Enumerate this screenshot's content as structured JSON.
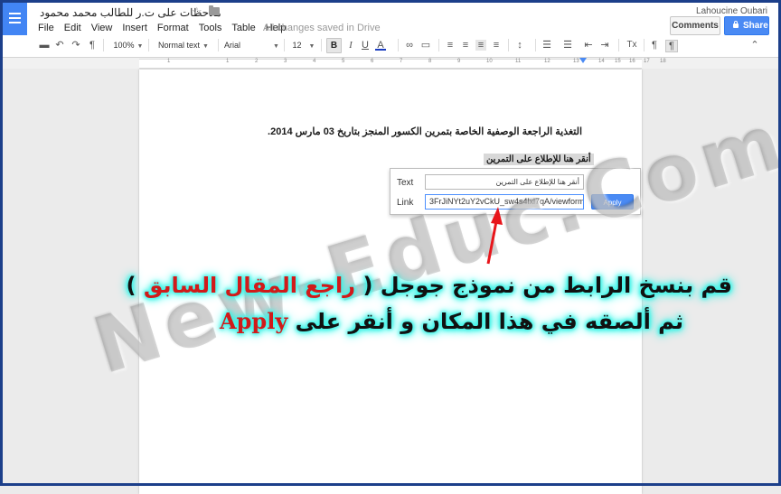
{
  "header": {
    "title": "ملاحظات على ت.ر للطالب محمد محمود",
    "save_status": "All changes saved in Drive",
    "user_name": "Lahoucine Oubari",
    "comments_label": "Comments",
    "share_label": "Share"
  },
  "menu": [
    "File",
    "Edit",
    "View",
    "Insert",
    "Format",
    "Tools",
    "Table",
    "Help"
  ],
  "toolbar": {
    "zoom": "100%",
    "style": "Normal text",
    "font": "Arial",
    "size": "12",
    "bold": "B",
    "italic": "I",
    "underline": "U",
    "text_color": "A",
    "clear_format": "Tx",
    "accent_color": "#4285f4"
  },
  "ruler": {
    "numbers": [
      "1",
      "1",
      "2",
      "3",
      "4",
      "5",
      "6",
      "7",
      "8",
      "9",
      "10",
      "11",
      "12",
      "13",
      "14",
      "15",
      "16",
      "17",
      "18"
    ]
  },
  "document": {
    "heading": "التغذية الراجعة الوصفية الخاصة بتمرين الكسور المنجز بتاريخ 03 مارس 2014.",
    "link_text": "أنقر هنا للإطلاع على التمرين"
  },
  "link_popup": {
    "text_label": "Text",
    "link_label": "Link",
    "text_value": "أنقر هنا للإطلاع على التمرين",
    "link_value": "3FrJiNYt2uY2vCkU_sw4s4lxl7qA/viewform",
    "apply_label": "Apply"
  },
  "watermark": "New-Educ.Com",
  "caption": {
    "line1_part1": "قم بنسخ الرابط من نموذج جوجل (",
    "line1_highlight": "راجع المقال السابق",
    "line1_part2": ")",
    "line2_part1": "ثم ألصقه في هذا المكان و أنقر على",
    "line2_highlight": "Apply"
  }
}
